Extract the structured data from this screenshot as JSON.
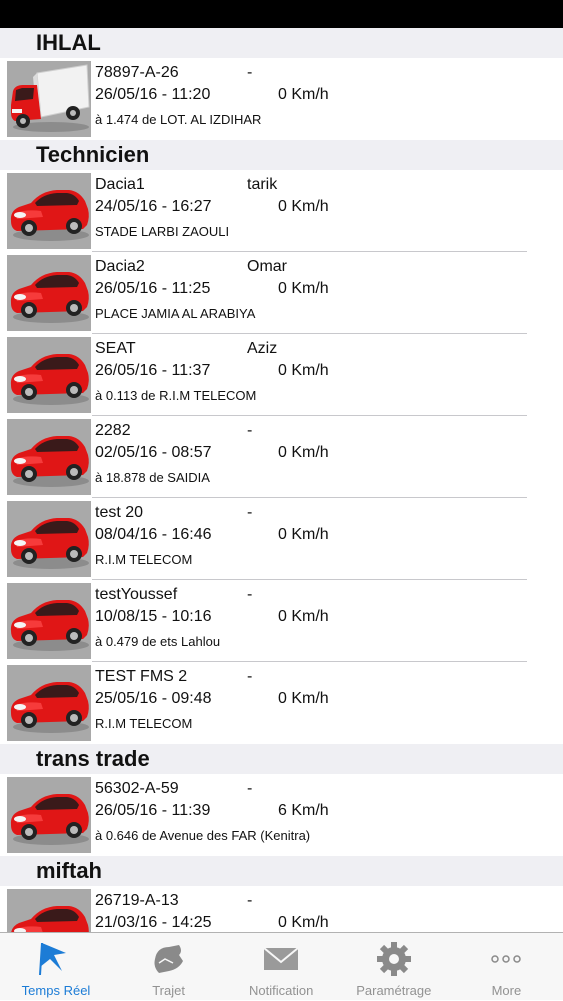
{
  "colors": {
    "accent": "#1c7cd6",
    "inactive": "#929292",
    "section_bg": "#efeff3",
    "vehicle_red": "#e01616"
  },
  "groups": [
    {
      "title": "IHLAL",
      "vehicles": [
        {
          "name": "78897-A-26",
          "driver": "-",
          "datetime": "26/05/16 - 11:20",
          "speed": "0 Km/h",
          "location": "à 1.474 de LOT. AL IZDIHAR",
          "icon": "truck-icon"
        }
      ]
    },
    {
      "title": "Technicien",
      "vehicles": [
        {
          "name": "Dacia1",
          "driver": "tarik",
          "datetime": "24/05/16 - 16:27",
          "speed": "0 Km/h",
          "location": "STADE LARBI ZAOULI",
          "icon": "car-icon"
        },
        {
          "name": "Dacia2",
          "driver": "Omar",
          "datetime": "26/05/16 - 11:25",
          "speed": "0 Km/h",
          "location": "PLACE JAMIA AL ARABIYA",
          "icon": "car-icon"
        },
        {
          "name": "SEAT",
          "driver": "Aziz",
          "datetime": "26/05/16 - 11:37",
          "speed": "0 Km/h",
          "location": "à 0.113 de R.I.M TELECOM",
          "icon": "car-icon"
        },
        {
          "name": "2282",
          "driver": "-",
          "datetime": "02/05/16 - 08:57",
          "speed": "0 Km/h",
          "location": "à 18.878 de SAIDIA",
          "icon": "car-icon"
        },
        {
          "name": "test 20",
          "driver": "-",
          "datetime": "08/04/16 - 16:46",
          "speed": "0 Km/h",
          "location": "R.I.M TELECOM",
          "icon": "car-icon"
        },
        {
          "name": "testYoussef",
          "driver": "-",
          "datetime": "10/08/15 - 10:16",
          "speed": "0 Km/h",
          "location": "à 0.479 de ets Lahlou",
          "icon": "car-icon"
        },
        {
          "name": "TEST FMS 2",
          "driver": "-",
          "datetime": "25/05/16 - 09:48",
          "speed": "0 Km/h",
          "location": "R.I.M TELECOM",
          "icon": "car-icon"
        }
      ]
    },
    {
      "title": "trans trade",
      "vehicles": [
        {
          "name": "56302-A-59",
          "driver": "-",
          "datetime": "26/05/16 - 11:39",
          "speed": "6 Km/h",
          "location": "à 0.646 de Avenue des FAR (Kenitra)",
          "icon": "car-icon"
        }
      ]
    },
    {
      "title": "miftah",
      "vehicles": [
        {
          "name": "26719-A-13",
          "driver": "-",
          "datetime": "21/03/16 - 14:25",
          "speed": "0 Km/h",
          "location": "",
          "icon": "car-icon"
        }
      ]
    }
  ],
  "tabbar": {
    "tabs": [
      {
        "label": "Temps Réel",
        "icon": "flag-icon",
        "active": true
      },
      {
        "label": "Trajet",
        "icon": "map-icon",
        "active": false
      },
      {
        "label": "Notification",
        "icon": "envelope-icon",
        "active": false
      },
      {
        "label": "Paramétrage",
        "icon": "gear-icon",
        "active": false
      },
      {
        "label": "More",
        "icon": "more-icon",
        "active": false
      }
    ]
  }
}
